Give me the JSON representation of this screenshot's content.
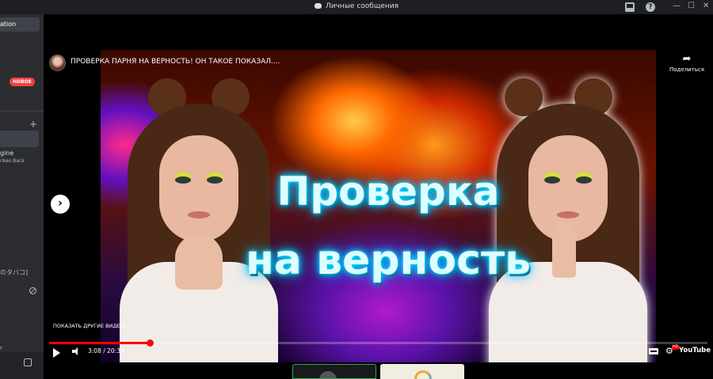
{
  "window": {
    "title": "Личные сообщения"
  },
  "sidebar": {
    "chip_label": "ation",
    "new_badge": "НОВОЕ",
    "add_symbol": "+",
    "item_line1": "gine",
    "item_line2": "rikes Back",
    "item_jp": "のタバコ]",
    "item_bottom": "r"
  },
  "video": {
    "title": "ПРОВЕРКА ПАРНЯ НА ВЕРНОСТЬ! ОН ТАКОЕ ПОКАЗАЛ....",
    "share_label": "Поделиться",
    "overlay_line1": "Проверка",
    "overlay_line2": "на верность",
    "more_videos_label": "ПОКАЗАТЬ ДРУГИЕ ВИДЕО",
    "time_display": "3:08 / 20:33",
    "progress_fraction": 0.153,
    "hd_badge": "HD",
    "youtube_label": "YouTube"
  },
  "icons": {
    "next": "chevron-right-icon",
    "play": "play-icon",
    "volume": "volume-icon",
    "captions": "captions-icon",
    "settings": "gear-icon",
    "share": "share-icon"
  },
  "colors": {
    "progress": "#ff0000",
    "discord_sidebar": "#2b2d31",
    "new_badge": "#f23f43",
    "neon_text": "#00e5ff"
  }
}
